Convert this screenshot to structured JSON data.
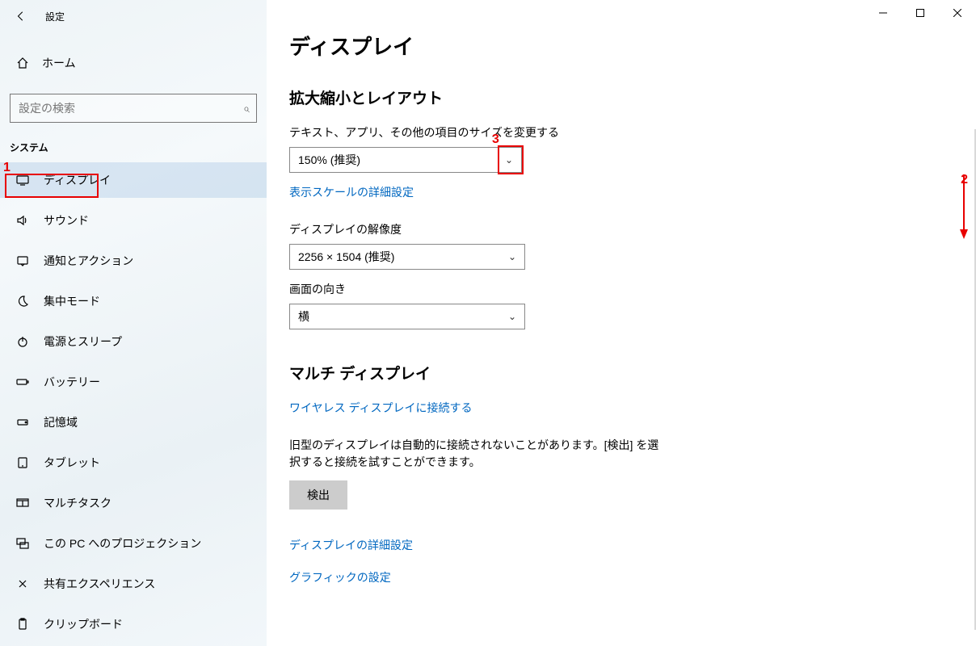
{
  "window": {
    "app_title": "設定"
  },
  "sidebar": {
    "home_label": "ホーム",
    "search_placeholder": "設定の検索",
    "category_label": "システム",
    "items": [
      {
        "label": "ディスプレイ",
        "icon": "monitor"
      },
      {
        "label": "サウンド",
        "icon": "speaker"
      },
      {
        "label": "通知とアクション",
        "icon": "notification"
      },
      {
        "label": "集中モード",
        "icon": "moon"
      },
      {
        "label": "電源とスリープ",
        "icon": "power"
      },
      {
        "label": "バッテリー",
        "icon": "battery"
      },
      {
        "label": "記憶域",
        "icon": "storage"
      },
      {
        "label": "タブレット",
        "icon": "tablet"
      },
      {
        "label": "マルチタスク",
        "icon": "multitask"
      },
      {
        "label": "この PC へのプロジェクション",
        "icon": "project"
      },
      {
        "label": "共有エクスペリエンス",
        "icon": "share"
      },
      {
        "label": "クリップボード",
        "icon": "clipboard"
      }
    ]
  },
  "main": {
    "page_title": "ディスプレイ",
    "section_scale_title": "拡大縮小とレイアウト",
    "scale_label": "テキスト、アプリ、その他の項目のサイズを変更する",
    "scale_value": "150% (推奨)",
    "scale_advanced_link": "表示スケールの詳細設定",
    "resolution_label": "ディスプレイの解像度",
    "resolution_value": "2256 × 1504 (推奨)",
    "orientation_label": "画面の向き",
    "orientation_value": "横",
    "section_multi_title": "マルチ ディスプレイ",
    "wireless_link": "ワイヤレス ディスプレイに接続する",
    "detect_desc": "旧型のディスプレイは自動的に接続されないことがあります。[検出] を選択すると接続を試すことができます。",
    "detect_button": "検出",
    "advanced_display_link": "ディスプレイの詳細設定",
    "graphics_link": "グラフィックの設定"
  },
  "annotations": {
    "n1": "1",
    "n2": "2",
    "n3": "3"
  }
}
